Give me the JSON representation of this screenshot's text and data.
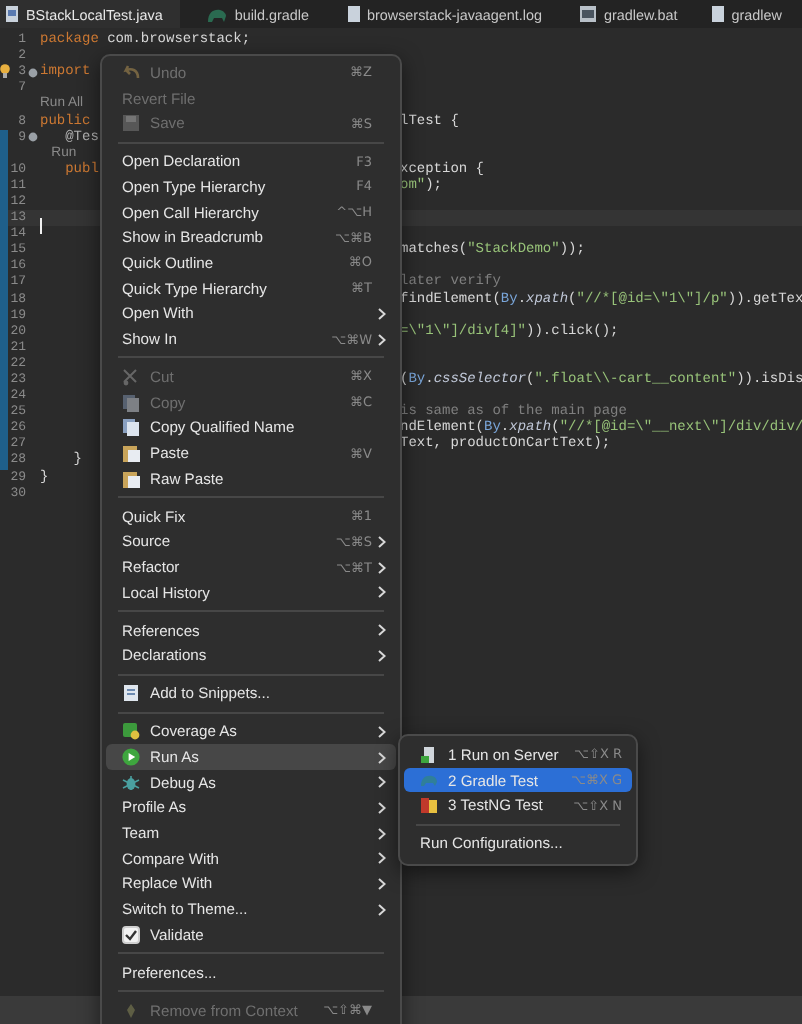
{
  "tabs": [
    {
      "label": "BStackLocalTest.java",
      "kind": "java",
      "selected": true
    },
    {
      "label": "build.gradle",
      "kind": "gradle",
      "selected": false
    },
    {
      "label": "browserstack-javaagent.log",
      "kind": "text",
      "selected": false
    },
    {
      "label": "gradlew.bat",
      "kind": "script",
      "selected": false
    },
    {
      "label": "gradlew",
      "kind": "text",
      "selected": false
    }
  ],
  "editor": {
    "lines": [
      {
        "number": "1",
        "left": [
          {
            "kind": "keyword",
            "text": "package"
          },
          {
            "kind": "plain",
            "text": " com.browserstack;"
          }
        ],
        "marked": false,
        "fold": false,
        "current": false
      },
      {
        "number": "2",
        "marked": false,
        "fold": false,
        "current": false
      },
      {
        "number": "3",
        "left": [
          {
            "kind": "keyword",
            "text": "import"
          }
        ],
        "marked": false,
        "fold": true,
        "current": false,
        "kind": "bulb"
      },
      {
        "number": "7",
        "marked": false,
        "fold": false,
        "current": false
      },
      {
        "left": [
          {
            "kind": "mining",
            "text": "Run All"
          }
        ],
        "marked": false,
        "fold": false,
        "current": false
      },
      {
        "number": "8",
        "left": [
          {
            "kind": "keyword",
            "text": "public"
          }
        ],
        "right": [
          {
            "kind": "plain",
            "text": "lTest {"
          }
        ],
        "marked": false,
        "fold": false,
        "current": false
      },
      {
        "number": "9",
        "left": [
          {
            "kind": "annotation",
            "text": "   @Tes"
          }
        ],
        "marked": true,
        "fold": true,
        "current": false
      },
      {
        "left": [
          {
            "kind": "mining",
            "text": "   Run"
          }
        ],
        "marked": true,
        "fold": false,
        "current": false
      },
      {
        "number": "10",
        "left": [
          {
            "kind": "keyword",
            "text": "   publ"
          }
        ],
        "right": [
          {
            "kind": "plain",
            "text": "xception {"
          }
        ],
        "marked": true,
        "fold": false,
        "current": false
      },
      {
        "number": "11",
        "right": [
          {
            "kind": "string",
            "text": "om\""
          },
          {
            "kind": "plain",
            "text": ");"
          }
        ],
        "marked": true,
        "fold": false,
        "current": false
      },
      {
        "number": "12",
        "marked": true,
        "fold": false,
        "current": false
      },
      {
        "number": "13",
        "marked": true,
        "fold": false,
        "current": true
      },
      {
        "number": "14",
        "marked": true,
        "fold": false,
        "current": false
      },
      {
        "number": "15",
        "right": [
          {
            "kind": "plain",
            "text": "matches("
          },
          {
            "kind": "string",
            "text": "\"StackDemo\""
          },
          {
            "kind": "plain",
            "text": "));"
          }
        ],
        "marked": true,
        "fold": false,
        "current": false
      },
      {
        "number": "16",
        "marked": true,
        "fold": false,
        "current": false
      },
      {
        "number": "17",
        "right": [
          {
            "kind": "comment",
            "text": "later verify"
          }
        ],
        "marked": true,
        "fold": false,
        "current": false
      },
      {
        "number": "18",
        "right": [
          {
            "kind": "plain",
            "text": "findElement("
          },
          {
            "kind": "type",
            "text": "By"
          },
          {
            "kind": "plain",
            "text": "."
          },
          {
            "kind": "method",
            "text": "xpath"
          },
          {
            "kind": "plain",
            "text": "("
          },
          {
            "kind": "string",
            "text": "\"//*[@id=\\\"1\\\"]/p\""
          },
          {
            "kind": "plain",
            "text": ")).getTex"
          }
        ],
        "marked": true,
        "fold": false,
        "current": false
      },
      {
        "number": "19",
        "marked": true,
        "fold": false,
        "current": false
      },
      {
        "number": "20",
        "right": [
          {
            "kind": "string",
            "text": "=\\\"1\\\"]/div[4]\""
          },
          {
            "kind": "plain",
            "text": ")).click();"
          }
        ],
        "marked": true,
        "fold": false,
        "current": false
      },
      {
        "number": "21",
        "marked": true,
        "fold": false,
        "current": false
      },
      {
        "number": "22",
        "marked": true,
        "fold": false,
        "current": false
      },
      {
        "number": "23",
        "right": [
          {
            "kind": "plain",
            "text": "("
          },
          {
            "kind": "type",
            "text": "By"
          },
          {
            "kind": "plain",
            "text": "."
          },
          {
            "kind": "method",
            "text": "cssSelector"
          },
          {
            "kind": "plain",
            "text": "("
          },
          {
            "kind": "string",
            "text": "\".float\\\\-cart__content\""
          },
          {
            "kind": "plain",
            "text": ")).isDis"
          }
        ],
        "marked": true,
        "fold": false,
        "current": false
      },
      {
        "number": "24",
        "marked": true,
        "fold": false,
        "current": false
      },
      {
        "number": "25",
        "right": [
          {
            "kind": "comment",
            "text": "is same as of the main page"
          }
        ],
        "marked": true,
        "fold": false,
        "current": false
      },
      {
        "number": "26",
        "right": [
          {
            "kind": "plain",
            "text": "ndElement("
          },
          {
            "kind": "type",
            "text": "By"
          },
          {
            "kind": "plain",
            "text": "."
          },
          {
            "kind": "method",
            "text": "xpath"
          },
          {
            "kind": "plain",
            "text": "("
          },
          {
            "kind": "string",
            "text": "\"//*[@id=\\\"__next\\\"]/div/div/"
          }
        ],
        "marked": true,
        "fold": false,
        "current": false
      },
      {
        "number": "27",
        "right": [
          {
            "kind": "plain",
            "text": "Text, productOnCartText);"
          }
        ],
        "marked": true,
        "fold": false,
        "current": false
      },
      {
        "number": "28",
        "left": [
          {
            "kind": "plain",
            "text": "    }"
          }
        ],
        "marked": true,
        "fold": false,
        "current": false
      },
      {
        "number": "29",
        "left": [
          {
            "kind": "plain",
            "text": "}"
          }
        ],
        "marked": false,
        "fold": false,
        "current": false
      },
      {
        "number": "30",
        "marked": false,
        "fold": false,
        "current": false
      }
    ]
  },
  "context_menu": {
    "items": [
      {
        "kind": "undo",
        "label": "Undo",
        "shortcut": "⌘Z",
        "submenu": false,
        "disabled": true,
        "highlighted": false
      },
      {
        "kind": "item",
        "label": "Revert File",
        "submenu": false,
        "disabled": true,
        "highlighted": false
      },
      {
        "kind": "save",
        "label": "Save",
        "shortcut": "⌘S",
        "submenu": false,
        "disabled": true,
        "highlighted": false
      },
      {
        "kind": "separator"
      },
      {
        "kind": "item",
        "label": "Open Declaration",
        "shortcut": "F3",
        "submenu": false,
        "disabled": false,
        "highlighted": false
      },
      {
        "kind": "item",
        "label": "Open Type Hierarchy",
        "shortcut": "F4",
        "submenu": false,
        "disabled": false,
        "highlighted": false
      },
      {
        "kind": "item",
        "label": "Open Call Hierarchy",
        "shortcut": "^⌥H",
        "submenu": false,
        "disabled": false,
        "highlighted": false
      },
      {
        "kind": "item",
        "label": "Show in Breadcrumb",
        "shortcut": "⌥⌘B",
        "submenu": false,
        "disabled": false,
        "highlighted": false
      },
      {
        "kind": "item",
        "label": "Quick Outline",
        "shortcut": "⌘O",
        "submenu": false,
        "disabled": false,
        "highlighted": false
      },
      {
        "kind": "item",
        "label": "Quick Type Hierarchy",
        "shortcut": "⌘T",
        "submenu": false,
        "disabled": false,
        "highlighted": false
      },
      {
        "kind": "item",
        "label": "Open With",
        "submenu": true,
        "disabled": false,
        "highlighted": false
      },
      {
        "kind": "item",
        "label": "Show In",
        "shortcut": "⌥⌘W",
        "submenu": true,
        "disabled": false,
        "highlighted": false
      },
      {
        "kind": "separator"
      },
      {
        "kind": "cut",
        "label": "Cut",
        "shortcut": "⌘X",
        "submenu": false,
        "disabled": true,
        "highlighted": false
      },
      {
        "kind": "copy",
        "label": "Copy",
        "shortcut": "⌘C",
        "submenu": false,
        "disabled": true,
        "highlighted": false
      },
      {
        "kind": "copy",
        "label": "Copy Qualified Name",
        "submenu": false,
        "disabled": false,
        "highlighted": false
      },
      {
        "kind": "paste",
        "label": "Paste",
        "shortcut": "⌘V",
        "submenu": false,
        "disabled": false,
        "highlighted": false
      },
      {
        "kind": "paste",
        "label": "Raw Paste",
        "submenu": false,
        "disabled": false,
        "highlighted": false
      },
      {
        "kind": "separator"
      },
      {
        "kind": "item",
        "label": "Quick Fix",
        "shortcut": "⌘1",
        "submenu": false,
        "disabled": false,
        "highlighted": false
      },
      {
        "kind": "item",
        "label": "Source",
        "shortcut": "⌥⌘S",
        "submenu": true,
        "disabled": false,
        "highlighted": false
      },
      {
        "kind": "item",
        "label": "Refactor",
        "shortcut": "⌥⌘T",
        "submenu": true,
        "disabled": false,
        "highlighted": false
      },
      {
        "kind": "item",
        "label": "Local History",
        "submenu": true,
        "disabled": false,
        "highlighted": false
      },
      {
        "kind": "separator"
      },
      {
        "kind": "item",
        "label": "References",
        "submenu": true,
        "disabled": false,
        "highlighted": false
      },
      {
        "kind": "item",
        "label": "Declarations",
        "submenu": true,
        "disabled": false,
        "highlighted": false
      },
      {
        "kind": "separator"
      },
      {
        "kind": "snippet",
        "label": "Add to Snippets...",
        "submenu": false,
        "disabled": false,
        "highlighted": false
      },
      {
        "kind": "separator"
      },
      {
        "kind": "coverage",
        "label": "Coverage As",
        "submenu": true,
        "disabled": false,
        "highlighted": false
      },
      {
        "kind": "run",
        "label": "Run As",
        "submenu": true,
        "disabled": false,
        "highlighted": true
      },
      {
        "kind": "debug",
        "label": "Debug As",
        "submenu": true,
        "disabled": false,
        "highlighted": false
      },
      {
        "kind": "item",
        "label": "Profile As",
        "submenu": true,
        "disabled": false,
        "highlighted": false
      },
      {
        "kind": "item",
        "label": "Team",
        "submenu": true,
        "disabled": false,
        "highlighted": false
      },
      {
        "kind": "item",
        "label": "Compare With",
        "submenu": true,
        "disabled": false,
        "highlighted": false
      },
      {
        "kind": "item",
        "label": "Replace With",
        "submenu": true,
        "disabled": false,
        "highlighted": false
      },
      {
        "kind": "item",
        "label": "Switch to Theme...",
        "submenu": true,
        "disabled": false,
        "highlighted": false
      },
      {
        "kind": "checkbox",
        "label": "Validate",
        "checked": true,
        "submenu": false,
        "disabled": false,
        "highlighted": false
      },
      {
        "kind": "separator"
      },
      {
        "kind": "item",
        "label": "Preferences...",
        "submenu": false,
        "disabled": false,
        "highlighted": false
      },
      {
        "kind": "separator"
      },
      {
        "kind": "remove",
        "label": "Remove from Context",
        "shortcut": "⌥⇧⌘▼",
        "submenu": false,
        "disabled": true,
        "highlighted": false
      }
    ]
  },
  "submenu": {
    "items": [
      {
        "kind": "server",
        "label": "1 Run on Server",
        "shortcut": "⌥⇧X R",
        "highlighted": false
      },
      {
        "kind": "gradle",
        "label": "2 Gradle Test",
        "shortcut": "⌥⌘X G",
        "highlighted": true
      },
      {
        "kind": "testng",
        "label": "3 TestNG Test",
        "shortcut": "⌥⇧X N",
        "highlighted": false
      },
      {
        "kind": "separator"
      },
      {
        "kind": "item",
        "label": "Run Configurations...",
        "highlighted": false
      }
    ]
  }
}
